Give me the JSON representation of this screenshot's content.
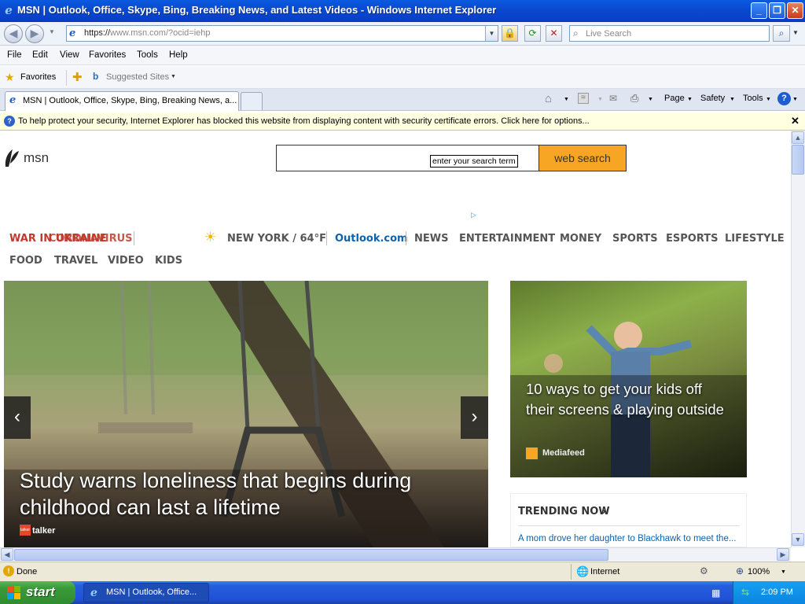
{
  "window": {
    "title": "MSN | Outlook, Office, Skype, Bing, Breaking News, and Latest Videos - Windows Internet Explorer"
  },
  "address": {
    "prefix": "https://",
    "domain": "www.msn.com",
    "path": "/?ocid=iehp"
  },
  "search_box": {
    "placeholder": "Live Search"
  },
  "menu": {
    "file": "File",
    "edit": "Edit",
    "view": "View",
    "favorites": "Favorites",
    "tools": "Tools",
    "help": "Help"
  },
  "favbar": {
    "favorites": "Favorites",
    "suggested": "Suggested Sites"
  },
  "tab": {
    "title": "MSN | Outlook, Office, Skype, Bing, Breaking News, a..."
  },
  "toolbar": {
    "page": "Page",
    "safety": "Safety",
    "tools": "Tools"
  },
  "infobar": {
    "message": "To help protect your security, Internet Explorer has blocked this website from displaying content with security certificate errors. Click here for options..."
  },
  "msn": {
    "logo": "msn",
    "search_button": "web search",
    "search_tooltip": "enter your search term",
    "alert_a": "WAR IN UKRAINE",
    "alert_b": "CORONAVIRUS",
    "weather": "NEW YORK / 64°F",
    "nav": {
      "outlook": "Outlook.com",
      "news": "NEWS",
      "entertainment": "ENTERTAINMENT",
      "money": "MONEY",
      "sports": "SPORTS",
      "esports": "ESPORTS",
      "lifestyle": "LIFESTYLE",
      "food": "FOOD",
      "travel": "TRAVEL",
      "video": "VIDEO",
      "kids": "KIDS"
    },
    "hero": {
      "headline": "Study warns loneliness that begins during childhood can last a lifetime",
      "source": "talker",
      "source_badge": "talker"
    },
    "side": {
      "headline": "10 ways to get your kids off their screens & playing outside",
      "source": "Mediafeed"
    },
    "trending": {
      "title": "TRENDING NOW",
      "first": "A mom drove her daughter to Blackhawk to meet the..."
    }
  },
  "status": {
    "text": "Done",
    "zone": "Internet",
    "zoom": "100%"
  },
  "taskbar": {
    "start": "start",
    "item": "MSN | Outlook, Office...",
    "clock": "2:09 PM"
  },
  "colors": {
    "title_blue": "#0a4ad0",
    "msn_orange": "#f6a623",
    "alert_red": "#c0392b",
    "outlook_blue": "#0a63b0"
  }
}
